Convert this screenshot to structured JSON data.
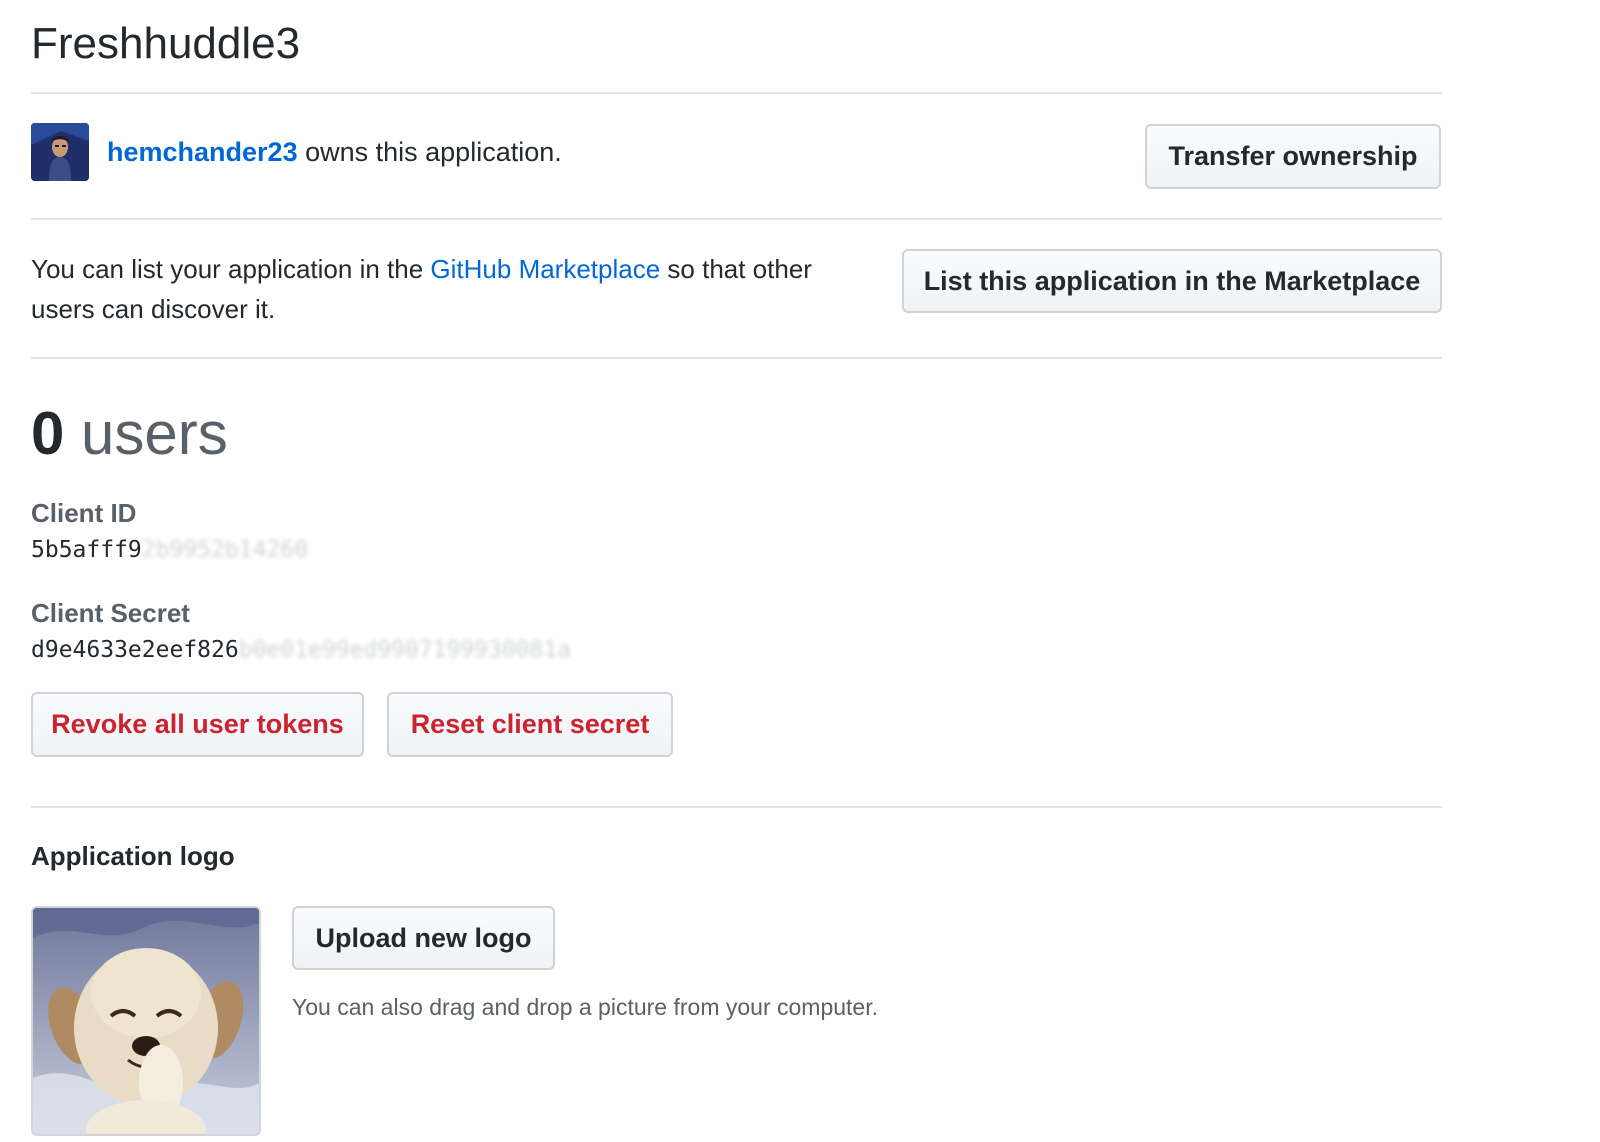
{
  "app": {
    "title": "Freshhuddle3"
  },
  "owner": {
    "username": "hemchander23",
    "suffix": " owns this application.",
    "transfer_button": "Transfer ownership"
  },
  "marketplace": {
    "text_before": "You can list your application in the ",
    "link": "GitHub Marketplace",
    "text_after": " so that other users can discover it.",
    "button": "List this application in the Marketplace"
  },
  "users": {
    "count": "0",
    "label": "users"
  },
  "credentials": {
    "client_id_label": "Client ID",
    "client_id_visible": "5b5afff9",
    "client_id_obscured": "2b9952b14260",
    "client_secret_label": "Client Secret",
    "client_secret_visible": "d9e4633e2eef826",
    "client_secret_obscured": "b0e01e99ed9907199930081a",
    "revoke_button": "Revoke all user tokens",
    "reset_button": "Reset client secret"
  },
  "logo": {
    "heading": "Application logo",
    "upload_button": "Upload new logo",
    "hint": "You can also drag and drop a picture from your computer."
  },
  "colors": {
    "link": "#0366d6",
    "danger": "#cb2431",
    "text": "#24292e",
    "muted": "#586069",
    "border": "#e1e4e8"
  }
}
